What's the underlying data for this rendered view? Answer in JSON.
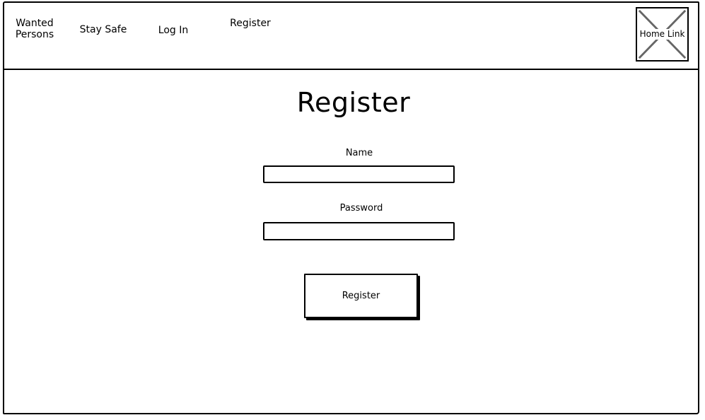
{
  "nav": {
    "items": [
      {
        "label": "Wanted\nPersons"
      },
      {
        "label": "Stay Safe"
      },
      {
        "label": "Log In"
      },
      {
        "label": "Register"
      }
    ],
    "home_link_label": "Home Link"
  },
  "page": {
    "title": "Register"
  },
  "form": {
    "name_label": "Name",
    "name_value": "",
    "password_label": "Password",
    "password_value": "",
    "submit_label": "Register"
  },
  "colors": {
    "stroke": "#000000",
    "background": "#ffffff",
    "placeholder_cross": "#666666"
  }
}
